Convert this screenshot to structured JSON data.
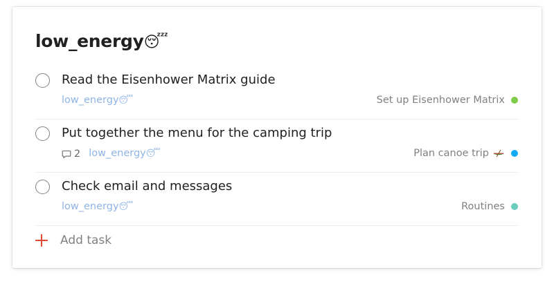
{
  "project": {
    "title": "low_energy",
    "title_emoji": "😴"
  },
  "tasks": [
    {
      "title": "Read the Eisenhower Matrix guide",
      "label": "low_energy",
      "label_emoji": "😴",
      "comments": null,
      "project": "Set up Eisenhower Matrix",
      "project_emoji": null,
      "project_color": "#7ecc49"
    },
    {
      "title": "Put together the menu for the camping trip",
      "label": "low_energy",
      "label_emoji": "😴",
      "comments": "2",
      "project": "Plan canoe trip",
      "project_emoji": "canoe-icon",
      "project_color": "#14aaf5"
    },
    {
      "title": "Check email and messages",
      "label": "low_energy",
      "label_emoji": "😴",
      "comments": null,
      "project": "Routines",
      "project_emoji": null,
      "project_color": "#6accbc"
    }
  ],
  "add_task": {
    "label": "Add task",
    "accent": "#dd4b39"
  }
}
